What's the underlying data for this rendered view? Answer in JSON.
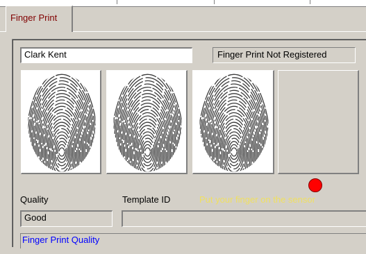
{
  "tabs": [
    {
      "label": "Finger Print"
    }
  ],
  "user": {
    "name": "Clark Kent"
  },
  "registration": {
    "status": "Finger Print Not Registered"
  },
  "fingerprints": [
    {
      "name": "fingerprint-sample-1",
      "captured": true
    },
    {
      "name": "fingerprint-sample-2",
      "captured": true
    },
    {
      "name": "fingerprint-sample-3",
      "captured": true
    },
    {
      "name": "fingerprint-sample-4",
      "captured": false
    }
  ],
  "indicator": {
    "color": "#ff0000",
    "icon": "status-led-icon"
  },
  "quality": {
    "label": "Quality",
    "value": "Good"
  },
  "template": {
    "label": "Template ID",
    "value": ""
  },
  "message": "Put your finger on the sensor",
  "quality_bar": {
    "label": "Finger Print Quality"
  },
  "colors": {
    "tab_text": "#800000",
    "message": "#f0e060",
    "quality_bar_text": "#0000ff",
    "background": "#d4d0c8"
  }
}
